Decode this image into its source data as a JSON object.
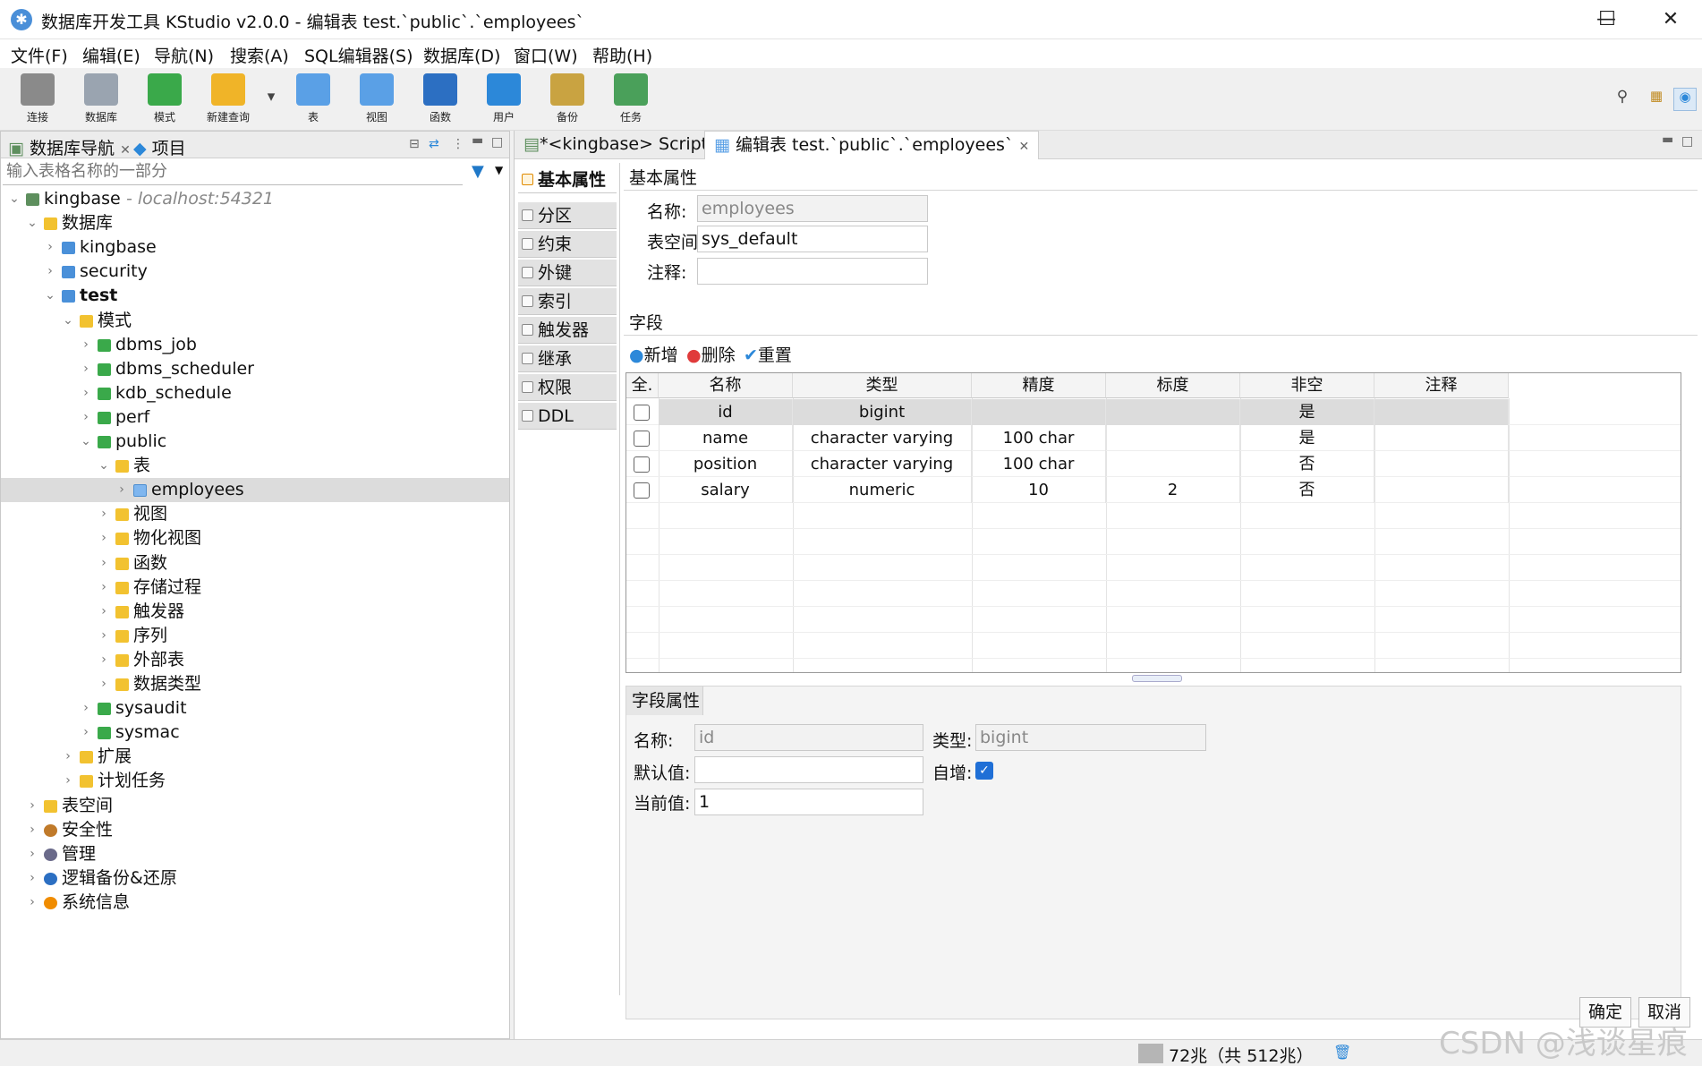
{
  "window": {
    "title": "数据库开发工具 KStudio v2.0.0 - 编辑表 test.`public`.`employees`"
  },
  "menu": [
    "文件(F)",
    "编辑(E)",
    "导航(N)",
    "搜索(A)",
    "SQL编辑器(S)",
    "数据库(D)",
    "窗口(W)",
    "帮助(H)"
  ],
  "toolbar": [
    {
      "label": "连接",
      "icon": "connect-icon",
      "color": "#8a8a8a"
    },
    {
      "label": "数据库",
      "icon": "database-icon",
      "color": "#9aa4b0"
    },
    {
      "label": "模式",
      "icon": "schema-icon",
      "color": "#3aa94a"
    },
    {
      "label": "新建查询",
      "icon": "new-query-icon",
      "color": "#f0b428"
    },
    {
      "label": "表",
      "icon": "table-icon",
      "color": "#5aa0e6"
    },
    {
      "label": "视图",
      "icon": "view-icon",
      "color": "#5aa0e6"
    },
    {
      "label": "函数",
      "icon": "function-icon",
      "color": "#2c6fc2"
    },
    {
      "label": "用户",
      "icon": "user-icon",
      "color": "#2c88d9"
    },
    {
      "label": "备份",
      "icon": "backup-icon",
      "color": "#c9a341"
    },
    {
      "label": "任务",
      "icon": "task-icon",
      "color": "#4aa05a"
    }
  ],
  "left": {
    "tabs": [
      "数据库导航",
      "项目"
    ],
    "filter_placeholder": "输入表格名称的一部分",
    "tree": [
      {
        "label": "kingbase",
        "detail": "- localhost:54321",
        "depth": 0,
        "icon": "root",
        "arrow": "⌄"
      },
      {
        "label": "数据库",
        "depth": 1,
        "icon": "fold",
        "arrow": "⌄"
      },
      {
        "label": "kingbase",
        "depth": 2,
        "icon": "db",
        "arrow": "›"
      },
      {
        "label": "security",
        "depth": 2,
        "icon": "db",
        "arrow": "›"
      },
      {
        "label": "test",
        "depth": 2,
        "icon": "db",
        "arrow": "⌄",
        "bold": true
      },
      {
        "label": "模式",
        "depth": 3,
        "icon": "fold",
        "arrow": "⌄"
      },
      {
        "label": "dbms_job",
        "depth": 4,
        "icon": "sch",
        "arrow": "›"
      },
      {
        "label": "dbms_scheduler",
        "depth": 4,
        "icon": "sch",
        "arrow": "›"
      },
      {
        "label": "kdb_schedule",
        "depth": 4,
        "icon": "sch",
        "arrow": "›"
      },
      {
        "label": "perf",
        "depth": 4,
        "icon": "sch",
        "arrow": "›"
      },
      {
        "label": "public",
        "depth": 4,
        "icon": "sch",
        "arrow": "⌄"
      },
      {
        "label": "表",
        "depth": 5,
        "icon": "fold",
        "arrow": "⌄"
      },
      {
        "label": "employees",
        "depth": 6,
        "icon": "tbl",
        "arrow": "›",
        "selected": true
      },
      {
        "label": "视图",
        "depth": 5,
        "icon": "fold",
        "arrow": "›"
      },
      {
        "label": "物化视图",
        "depth": 5,
        "icon": "fold",
        "arrow": "›"
      },
      {
        "label": "函数",
        "depth": 5,
        "icon": "fold",
        "arrow": "›"
      },
      {
        "label": "存储过程",
        "depth": 5,
        "icon": "fold",
        "arrow": "›"
      },
      {
        "label": "触发器",
        "depth": 5,
        "icon": "fold",
        "arrow": "›"
      },
      {
        "label": "序列",
        "depth": 5,
        "icon": "fold",
        "arrow": "›"
      },
      {
        "label": "外部表",
        "depth": 5,
        "icon": "fold",
        "arrow": "›"
      },
      {
        "label": "数据类型",
        "depth": 5,
        "icon": "fold",
        "arrow": "›"
      },
      {
        "label": "sysaudit",
        "depth": 4,
        "icon": "sch",
        "arrow": "›"
      },
      {
        "label": "sysmac",
        "depth": 4,
        "icon": "sch",
        "arrow": "›"
      },
      {
        "label": "扩展",
        "depth": 3,
        "icon": "fold",
        "arrow": "›"
      },
      {
        "label": "计划任务",
        "depth": 3,
        "icon": "fold",
        "arrow": "›"
      },
      {
        "label": "表空间",
        "depth": 1,
        "icon": "fold",
        "arrow": "›"
      },
      {
        "label": "安全性",
        "depth": 1,
        "icon": "security",
        "arrow": "›"
      },
      {
        "label": "管理",
        "depth": 1,
        "icon": "gear",
        "arrow": "›"
      },
      {
        "label": "逻辑备份&还原",
        "depth": 1,
        "icon": "layers",
        "arrow": "›"
      },
      {
        "label": "系统信息",
        "depth": 1,
        "icon": "info",
        "arrow": "›"
      }
    ]
  },
  "editor": {
    "tabs": [
      "*<kingbase> Script",
      "编辑表 test.`public`.`employees`"
    ],
    "side_tabs": [
      "基本属性",
      "分区",
      "约束",
      "外键",
      "索引",
      "触发器",
      "继承",
      "权限",
      "DDL"
    ],
    "basic": {
      "title": "基本属性",
      "name_label": "名称:",
      "name_value": "employees",
      "tablespace_label": "表空间:",
      "tablespace_value": "sys_default",
      "comment_label": "注释:",
      "comment_value": ""
    },
    "fields": {
      "title": "字段",
      "actions": [
        {
          "label": "新增",
          "icon": "add-icon",
          "color": "#2c88d9"
        },
        {
          "label": "删除",
          "icon": "delete-icon",
          "color": "#e03b3b"
        },
        {
          "label": "重置",
          "icon": "reset-icon",
          "color": "#2c88d9"
        }
      ],
      "columns": [
        "全.",
        "名称",
        "类型",
        "精度",
        "标度",
        "非空",
        "注释"
      ],
      "rows": [
        {
          "name": "id",
          "type": "bigint",
          "precision": "",
          "scale": "",
          "notnull": "是",
          "comment": "",
          "selected": true
        },
        {
          "name": "name",
          "type": "character varying",
          "precision": "100 char",
          "scale": "",
          "notnull": "是",
          "comment": ""
        },
        {
          "name": "position",
          "type": "character varying",
          "precision": "100 char",
          "scale": "",
          "notnull": "否",
          "comment": ""
        },
        {
          "name": "salary",
          "type": "numeric",
          "precision": "10",
          "scale": "2",
          "notnull": "否",
          "comment": ""
        }
      ]
    },
    "field_props": {
      "title": "字段属性",
      "name_label": "名称:",
      "name_value": "id",
      "type_label": "类型:",
      "type_value": "bigint",
      "default_label": "默认值:",
      "default_value": "",
      "autoinc_label": "自增:",
      "autoinc_checked": true,
      "current_label": "当前值:",
      "current_value": "1"
    },
    "buttons": {
      "ok": "确定",
      "cancel": "取消"
    }
  },
  "status": {
    "memory": "72兆（共 512兆）"
  },
  "watermark": "CSDN @浅谈星痕"
}
